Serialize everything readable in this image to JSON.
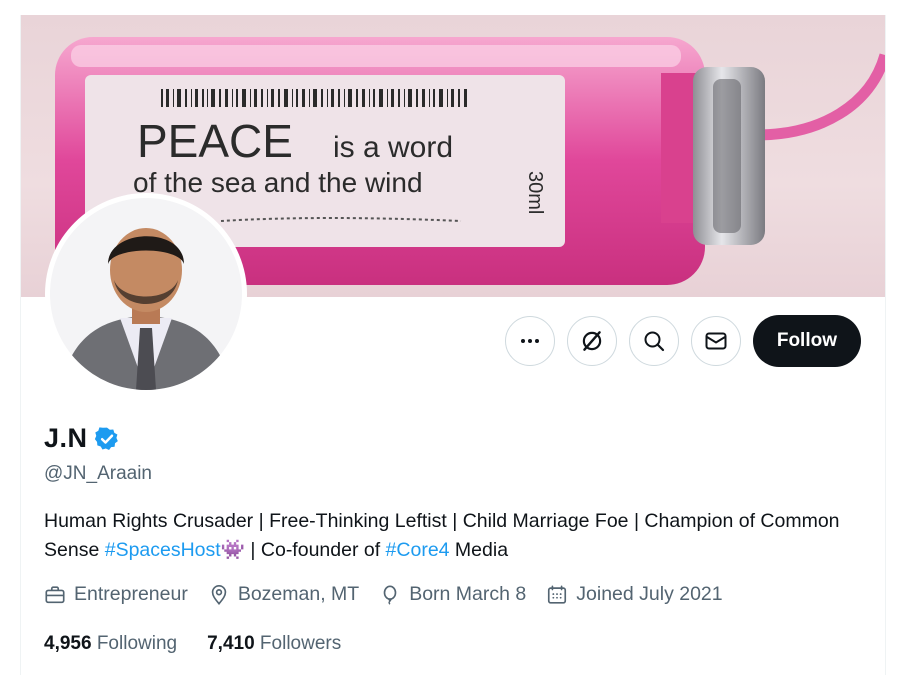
{
  "banner": {
    "vial_line1_big": "PEACE",
    "vial_line1_small": "is a word",
    "vial_line2": "of the sea and the wind",
    "vial_volume": "30ml"
  },
  "actions": {
    "more_icon": "more-horizontal-icon",
    "grok_icon": "grok-icon",
    "search_icon": "search-icon",
    "message_icon": "mail-icon",
    "follow_label": "Follow"
  },
  "profile": {
    "display_name": "J.N",
    "verified_icon": "verified-badge-icon",
    "handle": "@JN_Araain",
    "bio_part1": "Human Rights Crusader | Free-Thinking Leftist | Child Marriage Foe | Champion of Common Sense ",
    "bio_hashtag1": "#SpacesHost",
    "bio_emoji": "👾",
    "bio_part2": " | Co-founder of ",
    "bio_hashtag2": "#Core4",
    "bio_part3": " Media",
    "profession": "Entrepreneur",
    "location": "Bozeman, MT",
    "birthday": "Born March 8",
    "joined": "Joined July 2021",
    "following_count": "4,956",
    "following_label": "Following",
    "followers_count": "7,410",
    "followers_label": "Followers"
  },
  "colors": {
    "accent": "#1d9bf0",
    "text": "#0f1419",
    "muted": "#536471",
    "vial_pink": "#e0479a"
  }
}
